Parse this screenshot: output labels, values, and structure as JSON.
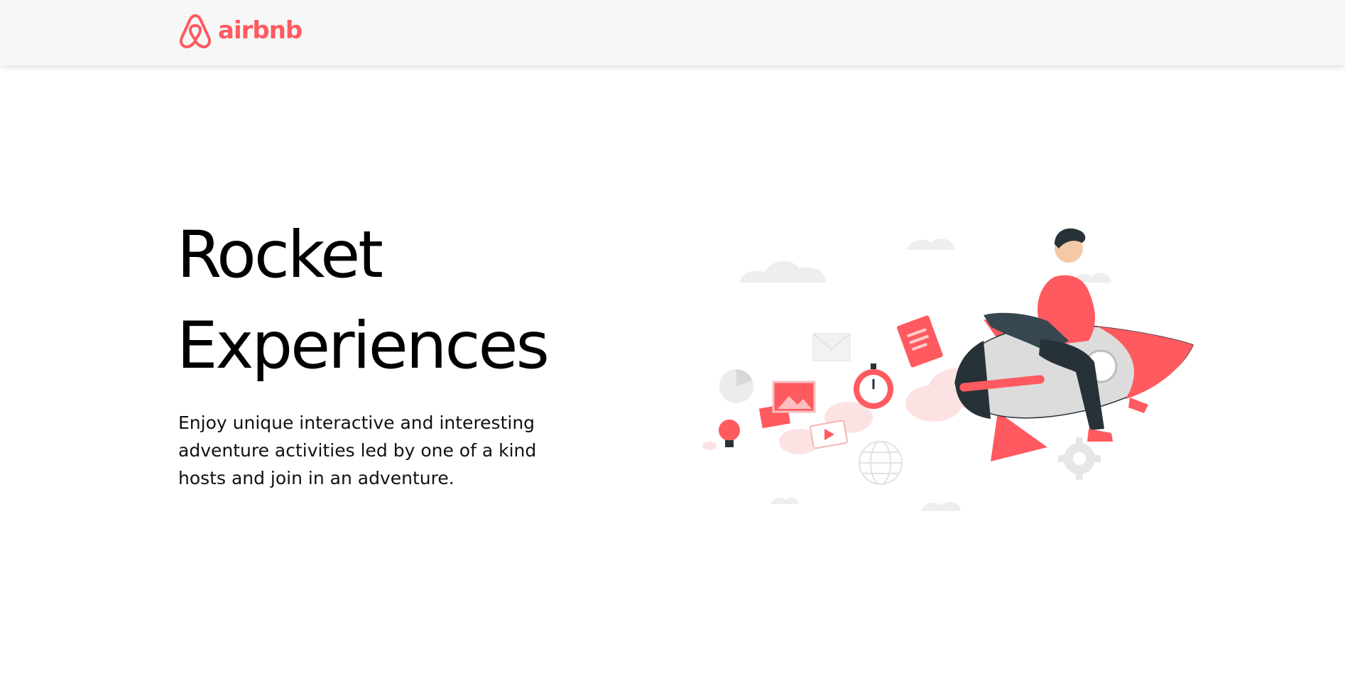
{
  "header": {
    "logo_text": "airbnb"
  },
  "hero": {
    "title_line1": "Rocket",
    "title_line2": "Experiences",
    "description": "Enjoy unique interactive and interesting adventure activities led by one of a kind hosts and join in an adventure."
  },
  "colors": {
    "brand": "#ff5a5f",
    "header_bg": "#f7f7f7",
    "text": "#000000"
  },
  "icons": [
    "airbnb-logo-icon",
    "rocket-illustration"
  ]
}
